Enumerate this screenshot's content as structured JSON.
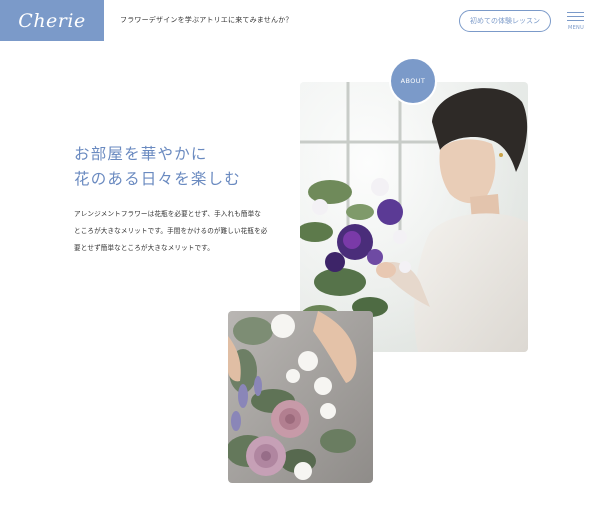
{
  "header": {
    "logo": "Cherie",
    "tagline": "フラワーデザインを学ぶアトリエに来てみませんか？",
    "trial_button": "初めての体験レッスン",
    "menu_label": "MENU"
  },
  "about": {
    "badge": "ABOUT",
    "heading_line1": "お部屋を華やかに",
    "heading_line2": "花のある日々を楽しむ",
    "body_line1": "アレンジメントフラワーは花瓶を必要とせず、手入れも簡単な",
    "body_line2": "ところが大きなメリットです。手間をかけるのが難しい花瓶を必",
    "body_line3": "要とせず簡単なところが大きなメリットです。"
  },
  "colors": {
    "accent": "#7b9ac9",
    "heading": "#6a8ac0"
  }
}
